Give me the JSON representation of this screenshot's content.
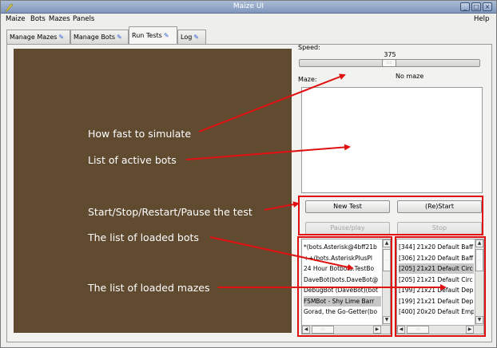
{
  "window": {
    "title": "Maize UI"
  },
  "menubar": {
    "items": [
      "Maize",
      "Bots",
      "Mazes",
      "Panels"
    ],
    "help": "Help"
  },
  "tabs": [
    "Manage Mazes",
    "Manage Bots",
    "Run Tests",
    "Log"
  ],
  "active_tab": "Run Tests",
  "speed": {
    "label": "Speed:",
    "value": "375"
  },
  "maze": {
    "label": "Maze:",
    "value": "No maze"
  },
  "buttons": {
    "new_test": "New Test",
    "restart": "(Re)Start",
    "pause": "Pause/play",
    "stop": "Stop"
  },
  "bots_list": [
    "*(bots.Asterisk@4bff21b",
    "++(bots.AsteriskPlusPl",
    "24 Hour Botbots.TestBo",
    "DaveBot(bots.DaveBot@",
    "DebugBot (DaveBot)(bot",
    "FSMBot - Shy Lime Barr",
    "Gorad, the Go-Getter(bo"
  ],
  "bots_selected_index": 5,
  "mazes_list": [
    "[344] 21x20 Default Baff",
    "[306] 21x20 Default Baff",
    "[205] 21x21 Default Circ",
    "[205] 21x21 Default Circ",
    "[199] 21x21 Default Dep",
    "[199] 21x21 Default Dep",
    "[400] 20x20 Default Emp"
  ],
  "mazes_selected_index": 2,
  "annotations": {
    "speed": "How fast to simulate",
    "active_bots": "List of active bots",
    "controls": "Start/Stop/Restart/Pause the test",
    "loaded_bots": "The list of loaded bots",
    "loaded_mazes": "The list of loaded mazes"
  },
  "colors": {
    "maze_background": "#604a30",
    "annotation": "#e01010",
    "titlebar": "#8aa0c4"
  }
}
